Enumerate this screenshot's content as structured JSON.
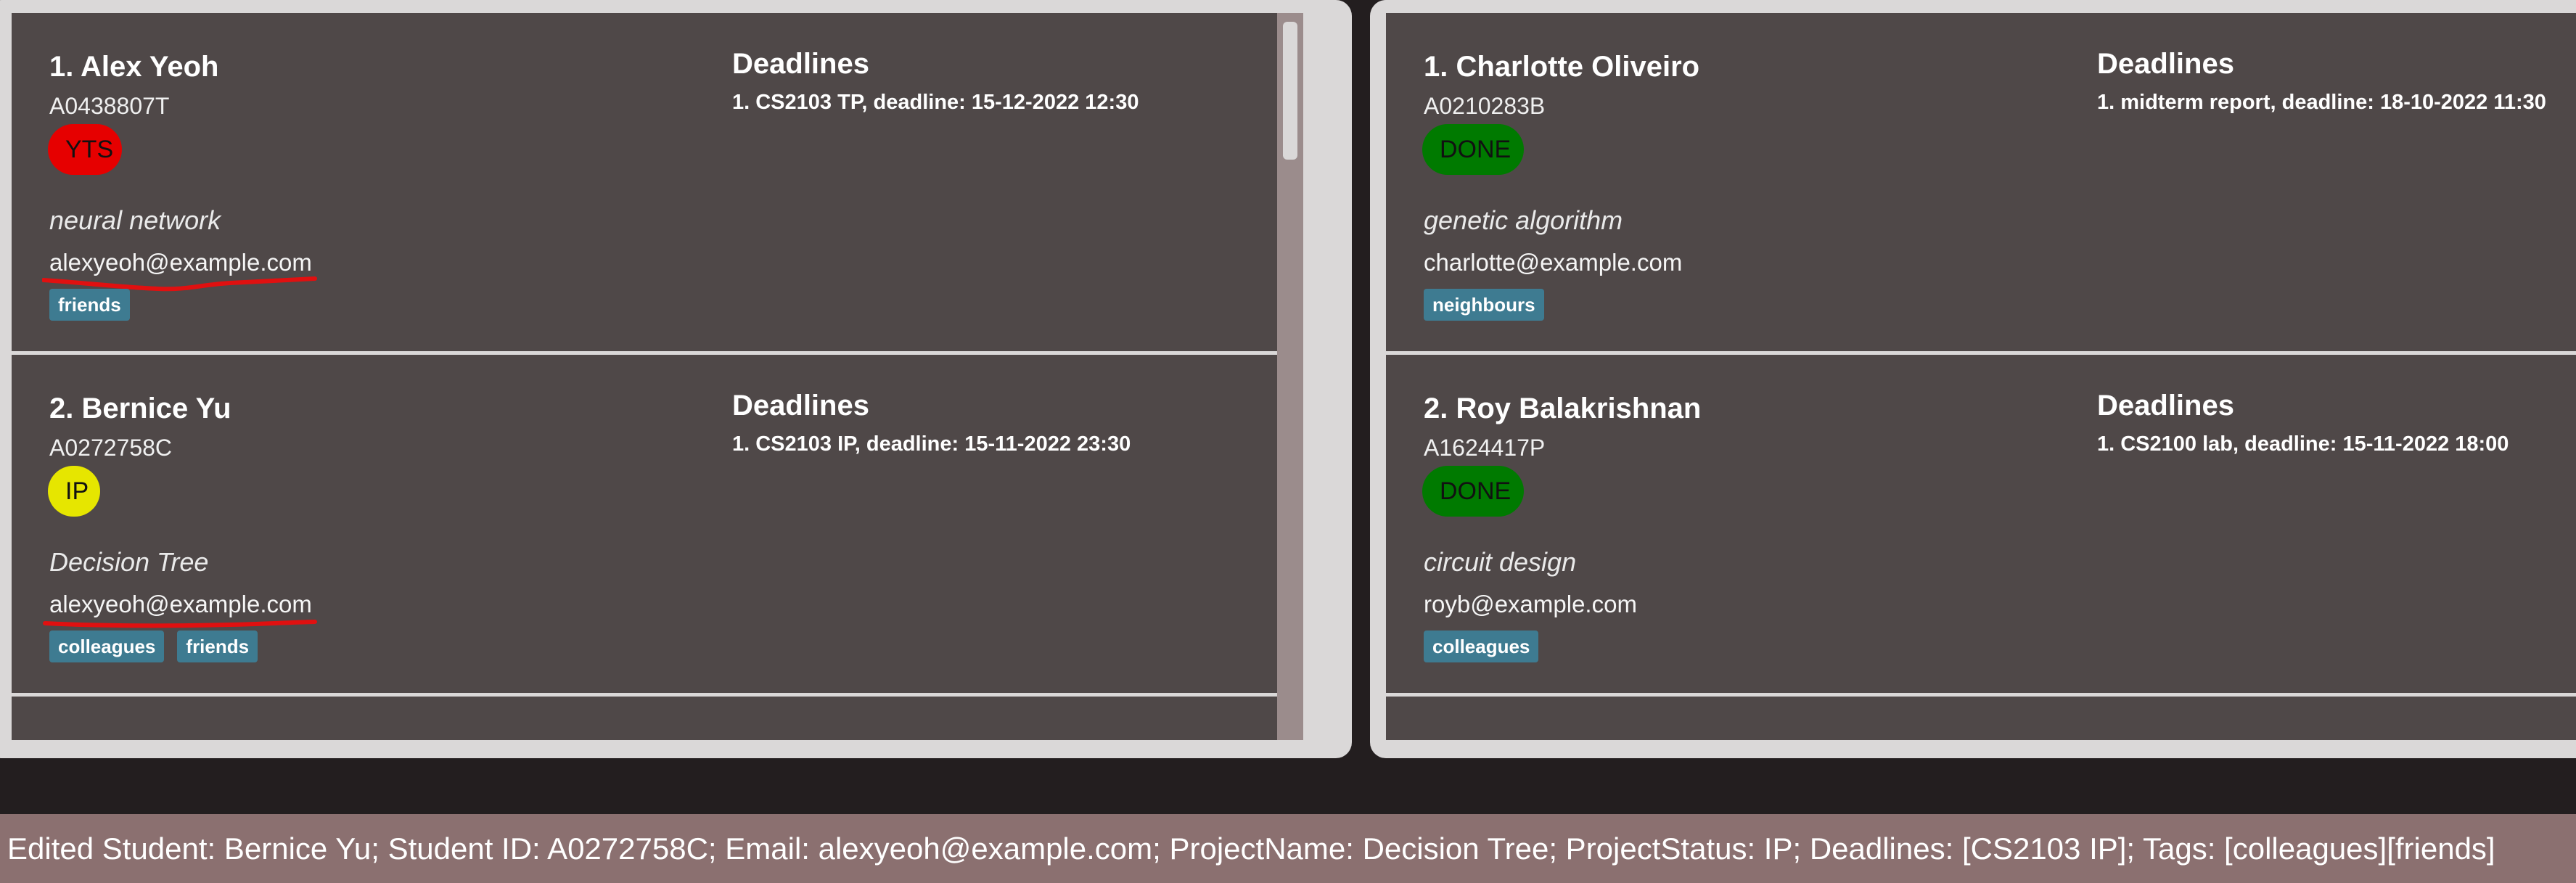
{
  "left_list": {
    "students": [
      {
        "index_name": "1.  Alex Yeoh",
        "student_id": "A0438807T",
        "status": "YTS",
        "status_color": "#e60000",
        "project": "neural network",
        "email": "alexyeoh@example.com",
        "email_annotated": true,
        "tags": [
          "friends"
        ],
        "deadlines_title": "Deadlines",
        "deadlines": [
          "1. CS2103 TP, deadline: 15-12-2022 12:30"
        ]
      },
      {
        "index_name": "2.  Bernice Yu",
        "student_id": "A0272758C",
        "status": "IP",
        "status_color": "#e6e600",
        "project": "Decision Tree",
        "email": "alexyeoh@example.com",
        "email_annotated": true,
        "tags": [
          "colleagues",
          "friends"
        ],
        "deadlines_title": "Deadlines",
        "deadlines": [
          "1. CS2103 IP, deadline: 15-11-2022 23:30"
        ]
      }
    ]
  },
  "right_list": {
    "students": [
      {
        "index_name": "1.  Charlotte Oliveiro",
        "student_id": "A0210283B",
        "status": "DONE",
        "status_color": "#007a00",
        "project": "genetic algorithm",
        "email": "charlotte@example.com",
        "tags": [
          "neighbours"
        ],
        "deadlines_title": "Deadlines",
        "deadlines": [
          "1. midterm report, deadline: 18-10-2022 11:30"
        ]
      },
      {
        "index_name": "2.  Roy Balakrishnan",
        "student_id": "A1624417P",
        "status": "DONE",
        "status_color": "#007a00",
        "project": "circuit design",
        "email": "royb@example.com",
        "tags": [
          "colleagues"
        ],
        "deadlines_title": "Deadlines",
        "deadlines": [
          "1. CS2100 lab, deadline: 15-11-2022 18:00"
        ]
      }
    ]
  },
  "result_display": {
    "text": "Edited Student: Bernice Yu; Student ID: A0272758C; Email: alexyeoh@example.com; ProjectName: Decision Tree; ProjectStatus: IP; Deadlines: [CS2103 IP]; Tags: [colleagues][friends]"
  },
  "colors": {
    "card_background": "#4f4848",
    "panel_border": "#dad8d8",
    "tag_background": "#3e7b91",
    "result_bar": "#8b7070",
    "annotation_red": "#e01010"
  }
}
